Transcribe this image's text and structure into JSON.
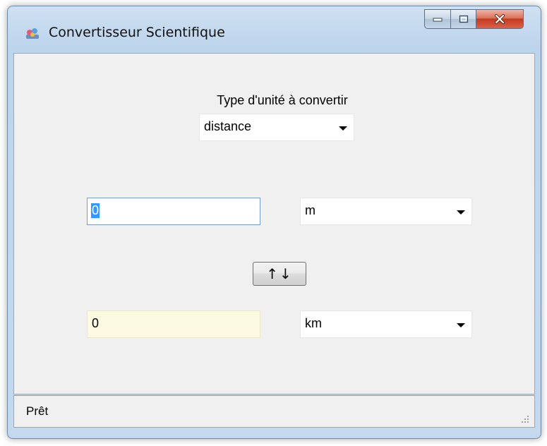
{
  "window": {
    "title": "Convertisseur Scientifique",
    "accent": "#c3391e"
  },
  "controls": {
    "minimize": "minimize-icon",
    "maximize": "maximize-icon",
    "close": "close-icon"
  },
  "unit_type": {
    "label": "Type d'unité à convertir",
    "selected": "distance"
  },
  "from": {
    "value": "0",
    "unit": "m"
  },
  "swap": {
    "label": "↑↓"
  },
  "to": {
    "value": "0",
    "unit": "km"
  },
  "status": {
    "text": "Prêt"
  }
}
